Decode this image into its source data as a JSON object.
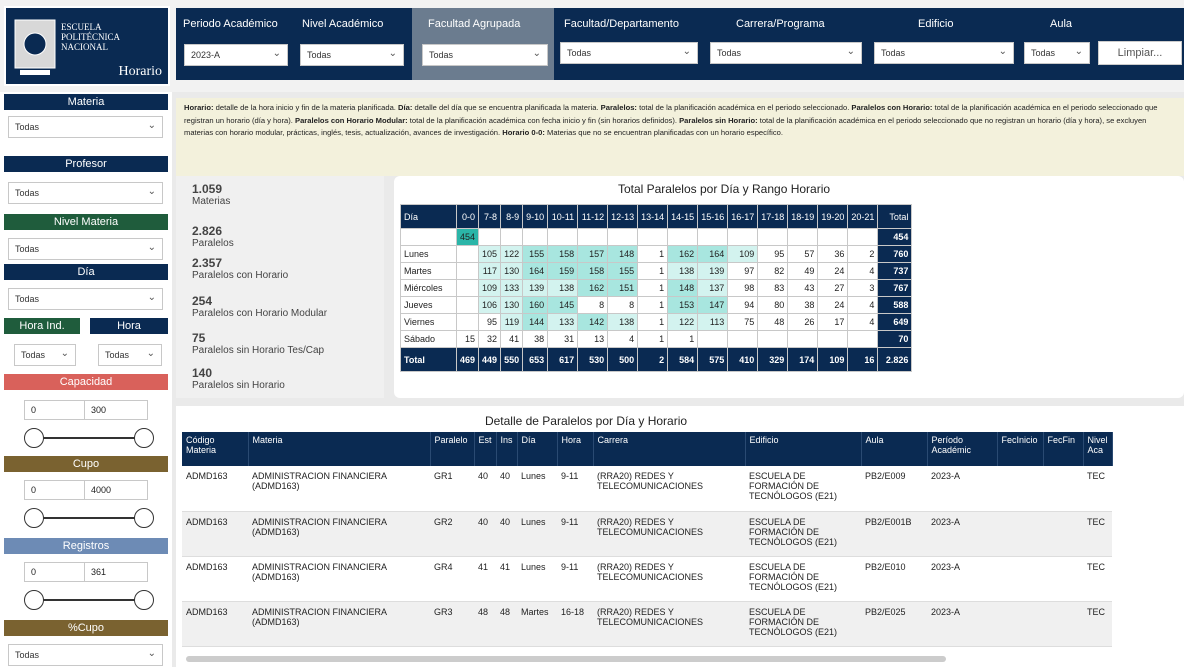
{
  "logo": {
    "line1": "ESCUELA",
    "line2": "POLITÉCNICA",
    "line3": "NACIONAL",
    "line4": "Horario"
  },
  "filters": {
    "periodo": {
      "label": "Periodo Académico",
      "value": "2023-A"
    },
    "nivel": {
      "label": "Nivel Académico",
      "value": "Todas"
    },
    "facultad_agrupada": {
      "label": "Facultad Agrupada",
      "value": "Todas"
    },
    "facultad": {
      "label": "Facultad/Departamento",
      "value": "Todas"
    },
    "carrera": {
      "label": "Carrera/Programa",
      "value": "Todas"
    },
    "edificio": {
      "label": "Edificio",
      "value": "Todas"
    },
    "aula": {
      "label": "Aula",
      "value": "Todas"
    },
    "limpiar": "Limpiar..."
  },
  "sidebar": {
    "materia": {
      "label": "Materia",
      "value": "Todas"
    },
    "profesor": {
      "label": "Profesor",
      "value": "Todas"
    },
    "nivel_materia": {
      "label": "Nivel Materia",
      "value": "Todas"
    },
    "dia": {
      "label": "Día",
      "value": "Todas"
    },
    "hora_ind": {
      "label": "Hora Ind.",
      "value": "Todas"
    },
    "hora": {
      "label": "Hora",
      "value": "Todas"
    },
    "capacidad": {
      "label": "Capacidad",
      "min": "0",
      "max": "300"
    },
    "cupo": {
      "label": "Cupo",
      "min": "0",
      "max": "4000"
    },
    "registros": {
      "label": "Registros",
      "min": "0",
      "max": "361"
    },
    "pct_cupo": {
      "label": "%Cupo",
      "value": "Todas"
    }
  },
  "info": {
    "t1": "Horario:",
    "d1": " detalle de la hora inicio y fin de la materia planificada. ",
    "t2": "Día:",
    "d2": " detalle del día que se encuentra planificada la materia. ",
    "t3": "Paralelos:",
    "d3": " total de la planificación académica en el periodo seleccionado. ",
    "t4": "Paralelos con Horario:",
    "d4": " total de la planificación académica en el periodo seleccionado que registran un horario (día y hora). ",
    "t5": "Paralelos con Horario Modular:",
    "d5": " total de la planificación académica con fecha inicio y fin (sin horarios definidos). ",
    "t6": "Paralelos sin Horario:",
    "d6": " total de la planificación académica en el periodo seleccionado que no registran un horario (día y hora), se excluyen materias con horario modular, prácticas, inglés, tesis, actualización, avances de investigación. ",
    "t7": "Horario 0-0:",
    "d7": " Materias que no se encuentran planificadas con un horario específico."
  },
  "kpis": [
    {
      "value": "1.059",
      "label": "Materias"
    },
    {
      "value": "2.826",
      "label": "Paralelos"
    },
    {
      "value": "2.357",
      "label": "Paralelos con Horario"
    },
    {
      "value": "254",
      "label": "Paralelos con Horario Modular"
    },
    {
      "value": "75",
      "label": "Paralelos sin Horario Tes/Cap"
    },
    {
      "value": "140",
      "label": "Paralelos sin Horario"
    }
  ],
  "pivot": {
    "title": "Total Paralelos por Día y Rango Horario",
    "headers": [
      "Día",
      "0-0",
      "7-8",
      "8-9",
      "9-10",
      "10-11",
      "11-12",
      "12-13",
      "13-14",
      "14-15",
      "15-16",
      "16-17",
      "17-18",
      "18-19",
      "19-20",
      "20-21",
      "Total"
    ],
    "rows": [
      [
        "",
        "454",
        "",
        "",
        "",
        "",
        "",
        "",
        "",
        "",
        "",
        "",
        "",
        "",
        "",
        "",
        "454"
      ],
      [
        "Lunes",
        "",
        "105",
        "122",
        "155",
        "158",
        "157",
        "148",
        "1",
        "162",
        "164",
        "109",
        "95",
        "57",
        "36",
        "2",
        "760"
      ],
      [
        "Martes",
        "",
        "117",
        "130",
        "164",
        "159",
        "158",
        "155",
        "1",
        "138",
        "139",
        "97",
        "82",
        "49",
        "24",
        "4",
        "737"
      ],
      [
        "Miércoles",
        "",
        "109",
        "133",
        "139",
        "138",
        "162",
        "151",
        "1",
        "148",
        "137",
        "98",
        "83",
        "43",
        "27",
        "3",
        "767"
      ],
      [
        "Jueves",
        "",
        "106",
        "130",
        "160",
        "145",
        "8",
        "8",
        "1",
        "153",
        "147",
        "94",
        "80",
        "38",
        "24",
        "4",
        "588"
      ],
      [
        "Viernes",
        "",
        "95",
        "119",
        "144",
        "133",
        "142",
        "138",
        "1",
        "122",
        "113",
        "75",
        "48",
        "26",
        "17",
        "4",
        "649"
      ],
      [
        "Sábado",
        "15",
        "32",
        "41",
        "38",
        "31",
        "13",
        "4",
        "1",
        "1",
        "",
        "",
        "",
        "",
        "",
        "",
        "70"
      ]
    ],
    "total": [
      "Total",
      "469",
      "449",
      "550",
      "653",
      "617",
      "530",
      "500",
      "2",
      "584",
      "575",
      "410",
      "329",
      "174",
      "109",
      "16",
      "2.826"
    ]
  },
  "detail": {
    "title": "Detalle de Paralelos por Día y Horario",
    "headers": [
      "Código Materia",
      "Materia",
      "Paralelo",
      "Est",
      "Ins",
      "Día",
      "Hora",
      "Carrera",
      "Edificio",
      "Aula",
      "Período Académic",
      "FecInicio",
      "FecFin",
      "Nivel Aca"
    ],
    "rows": [
      [
        "ADMD163",
        "ADMINISTRACION FINANCIERA (ADMD163)",
        "GR1",
        "40",
        "40",
        "Lunes",
        "9-11",
        "(RRA20) REDES Y TELECOMUNICACIONES",
        "ESCUELA DE FORMACIÓN DE TECNÓLOGOS (E21)",
        "PB2/E009",
        "2023-A",
        "",
        "",
        "TEC"
      ],
      [
        "ADMD163",
        "ADMINISTRACION FINANCIERA (ADMD163)",
        "GR2",
        "40",
        "40",
        "Lunes",
        "9-11",
        "(RRA20) REDES Y TELECOMUNICACIONES",
        "ESCUELA DE FORMACIÓN DE TECNÓLOGOS (E21)",
        "PB2/E001B",
        "2023-A",
        "",
        "",
        "TEC"
      ],
      [
        "ADMD163",
        "ADMINISTRACION FINANCIERA (ADMD163)",
        "GR4",
        "41",
        "41",
        "Lunes",
        "9-11",
        "(RRA20) REDES Y TELECOMUNICACIONES",
        "ESCUELA DE FORMACIÓN DE TECNÓLOGOS (E21)",
        "PB2/E010",
        "2023-A",
        "",
        "",
        "TEC"
      ],
      [
        "ADMD163",
        "ADMINISTRACION FINANCIERA (ADMD163)",
        "GR3",
        "48",
        "48",
        "Martes",
        "16-18",
        "(RRA20) REDES Y TELECOMUNICACIONES",
        "ESCUELA DE FORMACIÓN DE TECNÓLOGOS (E21)",
        "PB2/E025",
        "2023-A",
        "",
        "",
        "TEC"
      ]
    ]
  }
}
